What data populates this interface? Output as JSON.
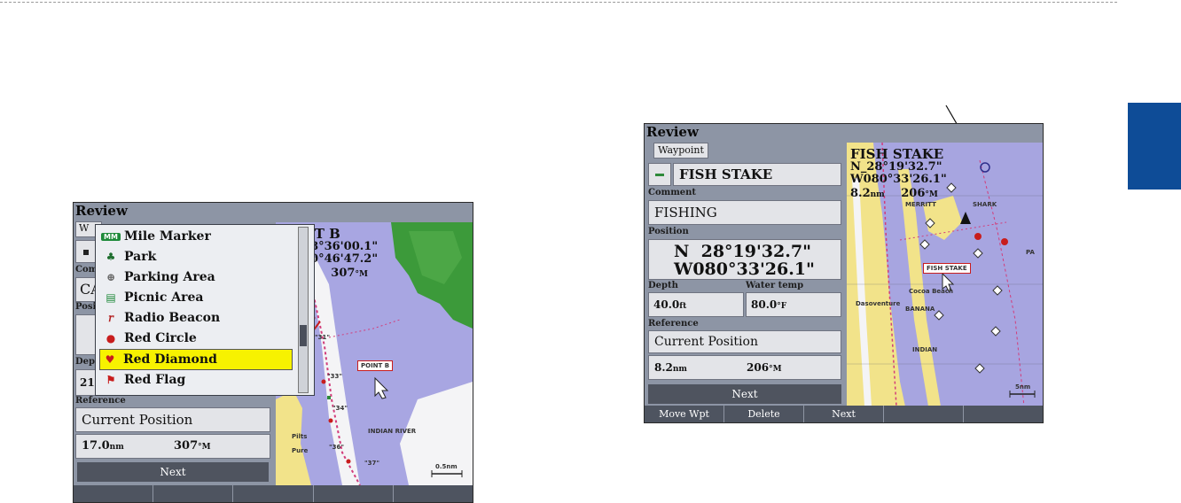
{
  "screen1": {
    "title": "Review",
    "tab_partial": "W",
    "comment_label_partial": "Com",
    "name_partial": "CA",
    "position_label_partial": "Posi",
    "depth_label_partial": "Dep",
    "depth_value_partial": "21.0",
    "reference_label": "Reference",
    "reference_value": "Current Position",
    "distance": "17.0",
    "distance_unit": "nm",
    "bearing": "307",
    "bearing_unit": "°M",
    "next_label": "Next",
    "softkeys": [
      "",
      "",
      "",
      "",
      ""
    ],
    "map": {
      "name_partial": "NT B",
      "lat_partial": "28°36'00.1\"",
      "lon_partial": "30°46'47.2\"",
      "dist_partial": "m",
      "bearing_partial": "307",
      "bearing_unit": "°M",
      "waypoint_tag": "POINT B",
      "river_label": "INDIAN RIVER",
      "depth_tags": [
        "\"31\"",
        "\"33\"",
        "\"34\"",
        "\"36\"",
        "\"37\""
      ],
      "scale_label": "0.5nm",
      "places": [
        "Pilts",
        "Pure"
      ]
    },
    "dropdown": {
      "items": [
        {
          "label": "Mile Marker",
          "icon": "mile-marker-icon",
          "glyph": "MM",
          "color": "#1e8a3a"
        },
        {
          "label": "Park",
          "icon": "park-icon",
          "glyph": "♣",
          "color": "#1e6e2e"
        },
        {
          "label": "Parking Area",
          "icon": "parking-icon",
          "glyph": "⊕",
          "color": "#6a6a6a"
        },
        {
          "label": "Picnic Area",
          "icon": "picnic-icon",
          "glyph": "▤",
          "color": "#1e8a3a"
        },
        {
          "label": "Radio Beacon",
          "icon": "radio-beacon-icon",
          "glyph": "𝑟",
          "color": "#b32020"
        },
        {
          "label": "Red Circle",
          "icon": "red-circle-icon",
          "glyph": "●",
          "color": "#c81d1d"
        },
        {
          "label": "Red Diamond",
          "icon": "red-diamond-icon",
          "glyph": "♥",
          "color": "#c81d1d"
        },
        {
          "label": "Red Flag",
          "icon": "red-flag-icon",
          "glyph": "⚑",
          "color": "#c81d1d"
        }
      ],
      "selected_index": 6
    }
  },
  "screen2": {
    "title": "Review",
    "tab": "Waypoint",
    "name": "FISH STAKE",
    "comment_label": "Comment",
    "comment": "FISHING",
    "position_label": "Position",
    "lat": "N  28°19'32.7\"",
    "lon": "W080°33'26.1\"",
    "depth_label": "Depth",
    "depth_value": "40.0",
    "depth_unit": "ft",
    "water_temp_label": "Water temp",
    "water_temp_value": "80.0",
    "water_temp_unit": "°F",
    "reference_label": "Reference",
    "reference_value": "Current Position",
    "distance": "8.2",
    "distance_unit": "nm",
    "bearing": "206",
    "bearing_unit": "°M",
    "next_label": "Next",
    "softkeys": [
      "Move Wpt",
      "Delete",
      "Next",
      "",
      ""
    ],
    "map": {
      "name": "FISH STAKE",
      "lat": "N_28°19'32.7\"",
      "lon": "W080°33'26.1\"",
      "dist": "8.2",
      "dist_unit": "nm",
      "bearing": "206",
      "bearing_unit": "°M",
      "waypoint_tag": "FISH STAKE",
      "places": [
        "SHARK",
        "MERRITT",
        "Cocoa Beach",
        "Dasoventure",
        "BANANA",
        "INDIAN",
        "PA"
      ],
      "scale_label": "5nm"
    }
  },
  "colors": {
    "tab_block": "#0e4c97",
    "land": "#f2e38a",
    "water": "#a8a6e2",
    "green_land": "#3c9a3a",
    "highlight": "#f7f200"
  }
}
